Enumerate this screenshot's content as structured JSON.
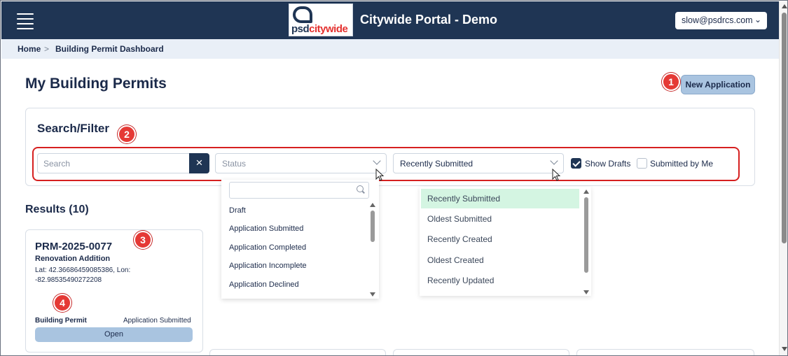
{
  "app": {
    "title": "Citywide Portal - Demo",
    "logo_text_a": "psd",
    "logo_text_b": "citywide",
    "user_email": "slow@psdrcs.com"
  },
  "breadcrumb": {
    "home": "Home",
    "separator": ">",
    "current": "Building Permit Dashboard"
  },
  "page": {
    "title": "My Building Permits",
    "new_application_label": "New Application"
  },
  "filter": {
    "title": "Search/Filter",
    "search_placeholder": "Search",
    "clear_icon": "×",
    "status_placeholder": "Status",
    "sort_value": "Recently Submitted",
    "show_drafts_label": "Show Drafts",
    "show_drafts_checked": true,
    "submitted_by_me_label": "Submitted by Me",
    "submitted_by_me_checked": false
  },
  "status_dropdown": {
    "options": [
      "Draft",
      "Application Submitted",
      "Application Completed",
      "Application Incomplete",
      "Application Declined"
    ]
  },
  "sort_dropdown": {
    "options": [
      "Recently Submitted",
      "Oldest Submitted",
      "Recently Created",
      "Oldest Created",
      "Recently Updated"
    ],
    "selected": "Recently Submitted"
  },
  "results": {
    "title": "Results (10)",
    "cards": [
      {
        "id": "PRM-2025-0077",
        "type": "Renovation Addition",
        "location": "Lat: 42.36686459085386, Lon: -82.98535490272208",
        "permit": "Building Permit",
        "status": "Application Submitted",
        "open_label": "Open"
      }
    ]
  },
  "callouts": [
    "1",
    "2",
    "3",
    "4"
  ],
  "colors": {
    "navbar": "#1f3554",
    "accent_button": "#a9c4e0",
    "callout": "#e53935",
    "highlight_box": "#d62020",
    "selected_option": "#d4f5e2"
  },
  "icons": {
    "menu": "hamburger-menu-icon",
    "user_menu": "chevron-down-icon",
    "clear": "close-icon",
    "search": "search-icon",
    "dropdown": "chevron-down-icon",
    "pointer": "mouse-cursor-icon"
  }
}
